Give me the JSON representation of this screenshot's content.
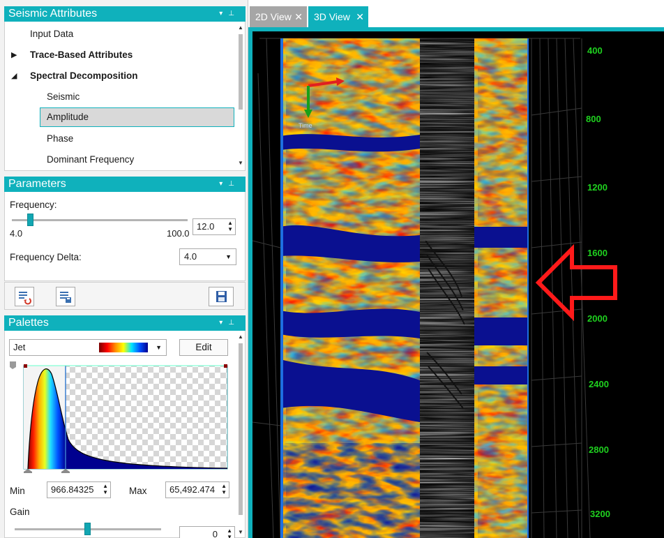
{
  "attributes_panel": {
    "title": "Seismic Attributes",
    "items": [
      {
        "label": "Input Data"
      },
      {
        "label": "Trace-Based Attributes"
      },
      {
        "label": "Spectral Decomposition"
      },
      {
        "label": "Seismic"
      },
      {
        "label": "Amplitude"
      },
      {
        "label": "Phase"
      },
      {
        "label": "Dominant Frequency"
      }
    ]
  },
  "parameters_panel": {
    "title": "Parameters",
    "frequency_label": "Frequency:",
    "frequency_min": "4.0",
    "frequency_max": "100.0",
    "frequency_value": "12.0",
    "frequency_delta_label": "Frequency Delta:",
    "frequency_delta_value": "4.0"
  },
  "palettes_panel": {
    "title": "Palettes",
    "palette_name": "Jet",
    "edit_label": "Edit",
    "min_label": "Min",
    "min_value": "966.84325",
    "max_label": "Max",
    "max_value": "65,492.474",
    "gain_label": "Gain",
    "gain_value": "0"
  },
  "tabs": [
    {
      "label": "2D View"
    },
    {
      "label": "3D View"
    }
  ],
  "depth_axis": {
    "ticks": [
      "400",
      "800",
      "1200",
      "1600",
      "2000",
      "2400",
      "2800",
      "3200"
    ]
  },
  "axis_gizmo_label": "Time",
  "colors": {
    "accent": "#0fb1bc",
    "axis_label": "#1fd11f",
    "arrow": "#ff1a1a"
  },
  "icons": {
    "panel_controls": [
      "dropdown-icon",
      "pin-icon"
    ],
    "toolbar": [
      "reset-icon",
      "save-settings-icon",
      "save-icon"
    ],
    "tab_close": "close-icon"
  }
}
